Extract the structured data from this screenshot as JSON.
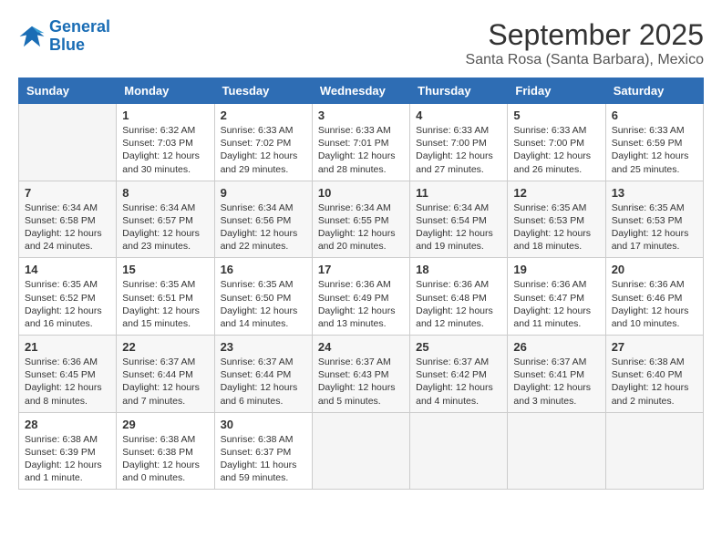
{
  "logo": {
    "line1": "General",
    "line2": "Blue"
  },
  "title": "September 2025",
  "subtitle": "Santa Rosa (Santa Barbara), Mexico",
  "days_of_week": [
    "Sunday",
    "Monday",
    "Tuesday",
    "Wednesday",
    "Thursday",
    "Friday",
    "Saturday"
  ],
  "weeks": [
    [
      {
        "day": "",
        "info": ""
      },
      {
        "day": "1",
        "info": "Sunrise: 6:32 AM\nSunset: 7:03 PM\nDaylight: 12 hours\nand 30 minutes."
      },
      {
        "day": "2",
        "info": "Sunrise: 6:33 AM\nSunset: 7:02 PM\nDaylight: 12 hours\nand 29 minutes."
      },
      {
        "day": "3",
        "info": "Sunrise: 6:33 AM\nSunset: 7:01 PM\nDaylight: 12 hours\nand 28 minutes."
      },
      {
        "day": "4",
        "info": "Sunrise: 6:33 AM\nSunset: 7:00 PM\nDaylight: 12 hours\nand 27 minutes."
      },
      {
        "day": "5",
        "info": "Sunrise: 6:33 AM\nSunset: 7:00 PM\nDaylight: 12 hours\nand 26 minutes."
      },
      {
        "day": "6",
        "info": "Sunrise: 6:33 AM\nSunset: 6:59 PM\nDaylight: 12 hours\nand 25 minutes."
      }
    ],
    [
      {
        "day": "7",
        "info": "Sunrise: 6:34 AM\nSunset: 6:58 PM\nDaylight: 12 hours\nand 24 minutes."
      },
      {
        "day": "8",
        "info": "Sunrise: 6:34 AM\nSunset: 6:57 PM\nDaylight: 12 hours\nand 23 minutes."
      },
      {
        "day": "9",
        "info": "Sunrise: 6:34 AM\nSunset: 6:56 PM\nDaylight: 12 hours\nand 22 minutes."
      },
      {
        "day": "10",
        "info": "Sunrise: 6:34 AM\nSunset: 6:55 PM\nDaylight: 12 hours\nand 20 minutes."
      },
      {
        "day": "11",
        "info": "Sunrise: 6:34 AM\nSunset: 6:54 PM\nDaylight: 12 hours\nand 19 minutes."
      },
      {
        "day": "12",
        "info": "Sunrise: 6:35 AM\nSunset: 6:53 PM\nDaylight: 12 hours\nand 18 minutes."
      },
      {
        "day": "13",
        "info": "Sunrise: 6:35 AM\nSunset: 6:53 PM\nDaylight: 12 hours\nand 17 minutes."
      }
    ],
    [
      {
        "day": "14",
        "info": "Sunrise: 6:35 AM\nSunset: 6:52 PM\nDaylight: 12 hours\nand 16 minutes."
      },
      {
        "day": "15",
        "info": "Sunrise: 6:35 AM\nSunset: 6:51 PM\nDaylight: 12 hours\nand 15 minutes."
      },
      {
        "day": "16",
        "info": "Sunrise: 6:35 AM\nSunset: 6:50 PM\nDaylight: 12 hours\nand 14 minutes."
      },
      {
        "day": "17",
        "info": "Sunrise: 6:36 AM\nSunset: 6:49 PM\nDaylight: 12 hours\nand 13 minutes."
      },
      {
        "day": "18",
        "info": "Sunrise: 6:36 AM\nSunset: 6:48 PM\nDaylight: 12 hours\nand 12 minutes."
      },
      {
        "day": "19",
        "info": "Sunrise: 6:36 AM\nSunset: 6:47 PM\nDaylight: 12 hours\nand 11 minutes."
      },
      {
        "day": "20",
        "info": "Sunrise: 6:36 AM\nSunset: 6:46 PM\nDaylight: 12 hours\nand 10 minutes."
      }
    ],
    [
      {
        "day": "21",
        "info": "Sunrise: 6:36 AM\nSunset: 6:45 PM\nDaylight: 12 hours\nand 8 minutes."
      },
      {
        "day": "22",
        "info": "Sunrise: 6:37 AM\nSunset: 6:44 PM\nDaylight: 12 hours\nand 7 minutes."
      },
      {
        "day": "23",
        "info": "Sunrise: 6:37 AM\nSunset: 6:44 PM\nDaylight: 12 hours\nand 6 minutes."
      },
      {
        "day": "24",
        "info": "Sunrise: 6:37 AM\nSunset: 6:43 PM\nDaylight: 12 hours\nand 5 minutes."
      },
      {
        "day": "25",
        "info": "Sunrise: 6:37 AM\nSunset: 6:42 PM\nDaylight: 12 hours\nand 4 minutes."
      },
      {
        "day": "26",
        "info": "Sunrise: 6:37 AM\nSunset: 6:41 PM\nDaylight: 12 hours\nand 3 minutes."
      },
      {
        "day": "27",
        "info": "Sunrise: 6:38 AM\nSunset: 6:40 PM\nDaylight: 12 hours\nand 2 minutes."
      }
    ],
    [
      {
        "day": "28",
        "info": "Sunrise: 6:38 AM\nSunset: 6:39 PM\nDaylight: 12 hours\nand 1 minute."
      },
      {
        "day": "29",
        "info": "Sunrise: 6:38 AM\nSunset: 6:38 PM\nDaylight: 12 hours\nand 0 minutes."
      },
      {
        "day": "30",
        "info": "Sunrise: 6:38 AM\nSunset: 6:37 PM\nDaylight: 11 hours\nand 59 minutes."
      },
      {
        "day": "",
        "info": ""
      },
      {
        "day": "",
        "info": ""
      },
      {
        "day": "",
        "info": ""
      },
      {
        "day": "",
        "info": ""
      }
    ]
  ]
}
